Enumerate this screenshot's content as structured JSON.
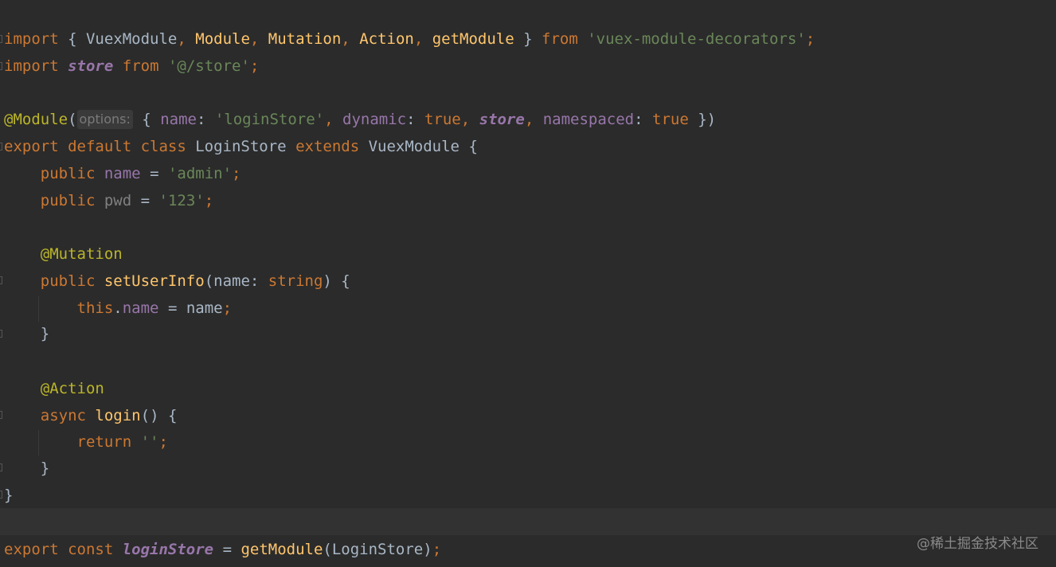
{
  "code": {
    "l1": {
      "kw_import": "import",
      "brace_open": " { ",
      "t_vuexmodule": "VuexModule",
      "comma": ", ",
      "t_module": "Module",
      "t_mutation": "Mutation",
      "t_action": "Action",
      "t_getmodule": "getModule",
      "brace_close": " } ",
      "kw_from": "from",
      "src": "'vuex-module-decorators'",
      "semi": ";"
    },
    "l2": {
      "kw_import": "import",
      "v_store": "store",
      "kw_from": "from",
      "src": "'@/store'",
      "semi": ";"
    },
    "l4": {
      "ann": "@Module",
      "paren_open": "(",
      "hint": "options:",
      "brace_open": " { ",
      "p_name": "name",
      "colon": ": ",
      "s_login": "'loginStore'",
      "comma": ", ",
      "p_dynamic": "dynamic",
      "k_true": "true",
      "v_store": "store",
      "p_namespaced": "namespaced",
      "close": " })"
    },
    "l5": {
      "kw": "export default class",
      "cls": "LoginStore",
      "kw_extends": "extends",
      "base": "VuexModule",
      "brace": " {"
    },
    "l6": {
      "kw": "public",
      "prop": "name",
      "eq": " = ",
      "val": "'admin'",
      "semi": ";"
    },
    "l7": {
      "kw": "public",
      "prop": "pwd",
      "eq": " = ",
      "val": "'123'",
      "semi": ";"
    },
    "l9": {
      "ann": "@Mutation"
    },
    "l10": {
      "kw": "public",
      "fn": "setUserInfo",
      "params": "(name: ",
      "type": "string",
      "close": ") {"
    },
    "l11": {
      "kw_this": "this",
      "dot": ".",
      "prop": "name",
      "rest": " = name",
      "semi": ";"
    },
    "l12": {
      "brace": "}"
    },
    "l14": {
      "ann": "@Action"
    },
    "l15": {
      "kw": "async",
      "fn": "login",
      "rest": "() {"
    },
    "l16": {
      "kw": "return",
      "val": "''",
      "semi": ";"
    },
    "l17": {
      "brace": "}"
    },
    "l18": {
      "brace": "}"
    },
    "l20": {
      "kw": "export const",
      "v_login": "loginStore",
      "eq": " = ",
      "fn": "getModule",
      "args": "(LoginStore)",
      "semi": ";"
    }
  },
  "watermark": "@稀土掘金技术社区"
}
